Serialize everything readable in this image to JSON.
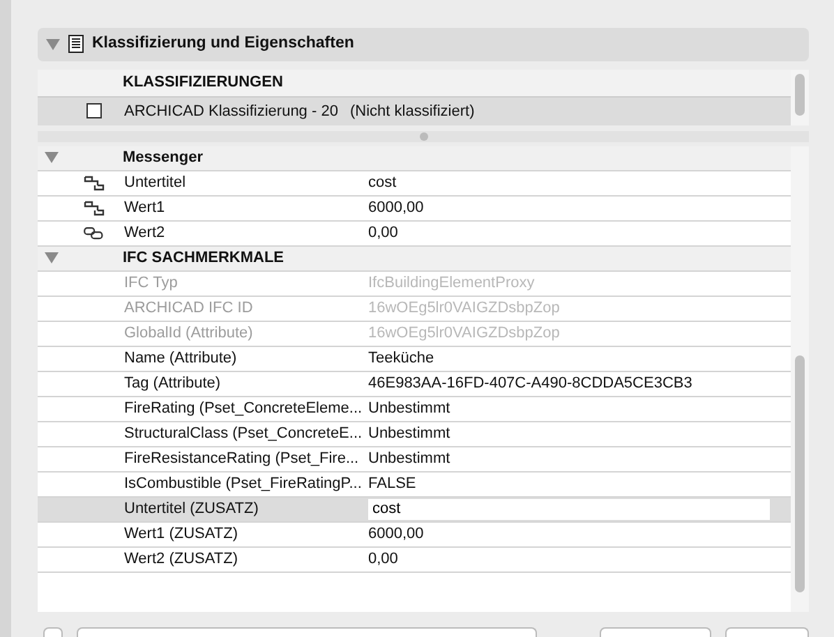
{
  "panel": {
    "title": "Klassifizierung und Eigenschaften",
    "expanded": true
  },
  "classifications": {
    "heading": "KLASSIFIZIERUNGEN",
    "rows": [
      {
        "name": "ARCHICAD Klassifizierung - 20",
        "value": "(Nicht klassifiziert)",
        "checked": false
      }
    ]
  },
  "property_groups": [
    {
      "title": "Messenger",
      "expanded": true,
      "rows": [
        {
          "kind": "split-link",
          "label": "Untertitel",
          "value": "cost",
          "disabled": false,
          "selected": false
        },
        {
          "kind": "split-link",
          "label": "Wert1",
          "value": "6000,00",
          "disabled": false,
          "selected": false
        },
        {
          "kind": "chain-link",
          "label": "Wert2",
          "value": "0,00",
          "disabled": false,
          "selected": false
        }
      ]
    },
    {
      "title": "IFC SACHMERKMALE",
      "expanded": true,
      "rows": [
        {
          "kind": "plain",
          "label": "IFC Typ",
          "value": "IfcBuildingElementProxy",
          "disabled": true,
          "selected": false
        },
        {
          "kind": "plain",
          "label": "ARCHICAD IFC ID",
          "value": "16wOEg5lr0VAIGZDsbpZop",
          "disabled": true,
          "selected": false
        },
        {
          "kind": "plain",
          "label": "GlobalId (Attribute)",
          "value": "16wOEg5lr0VAIGZDsbpZop",
          "disabled": true,
          "selected": false
        },
        {
          "kind": "plain",
          "label": "Name (Attribute)",
          "value": "Teeküche",
          "disabled": false,
          "selected": false
        },
        {
          "kind": "plain",
          "label": "Tag (Attribute)",
          "value": "46E983AA-16FD-407C-A490-8CDDA5CE3CB3",
          "disabled": false,
          "selected": false
        },
        {
          "kind": "plain",
          "label": "FireRating (Pset_ConcreteEleme...",
          "value": "Unbestimmt",
          "disabled": false,
          "selected": false
        },
        {
          "kind": "plain",
          "label": "StructuralClass (Pset_ConcreteE...",
          "value": "Unbestimmt",
          "disabled": false,
          "selected": false
        },
        {
          "kind": "plain",
          "label": "FireResistanceRating (Pset_Fire...",
          "value": "Unbestimmt",
          "disabled": false,
          "selected": false
        },
        {
          "kind": "plain",
          "label": "IsCombustible (Pset_FireRatingP...",
          "value": "FALSE",
          "disabled": false,
          "selected": false
        },
        {
          "kind": "plain",
          "label": "Untertitel (ZUSATZ)",
          "value": "cost",
          "disabled": false,
          "selected": true
        },
        {
          "kind": "plain",
          "label": "Wert1 (ZUSATZ)",
          "value": "6000,00",
          "disabled": false,
          "selected": false
        },
        {
          "kind": "plain",
          "label": "Wert2 (ZUSATZ)",
          "value": "0,00",
          "disabled": false,
          "selected": false
        }
      ]
    }
  ]
}
